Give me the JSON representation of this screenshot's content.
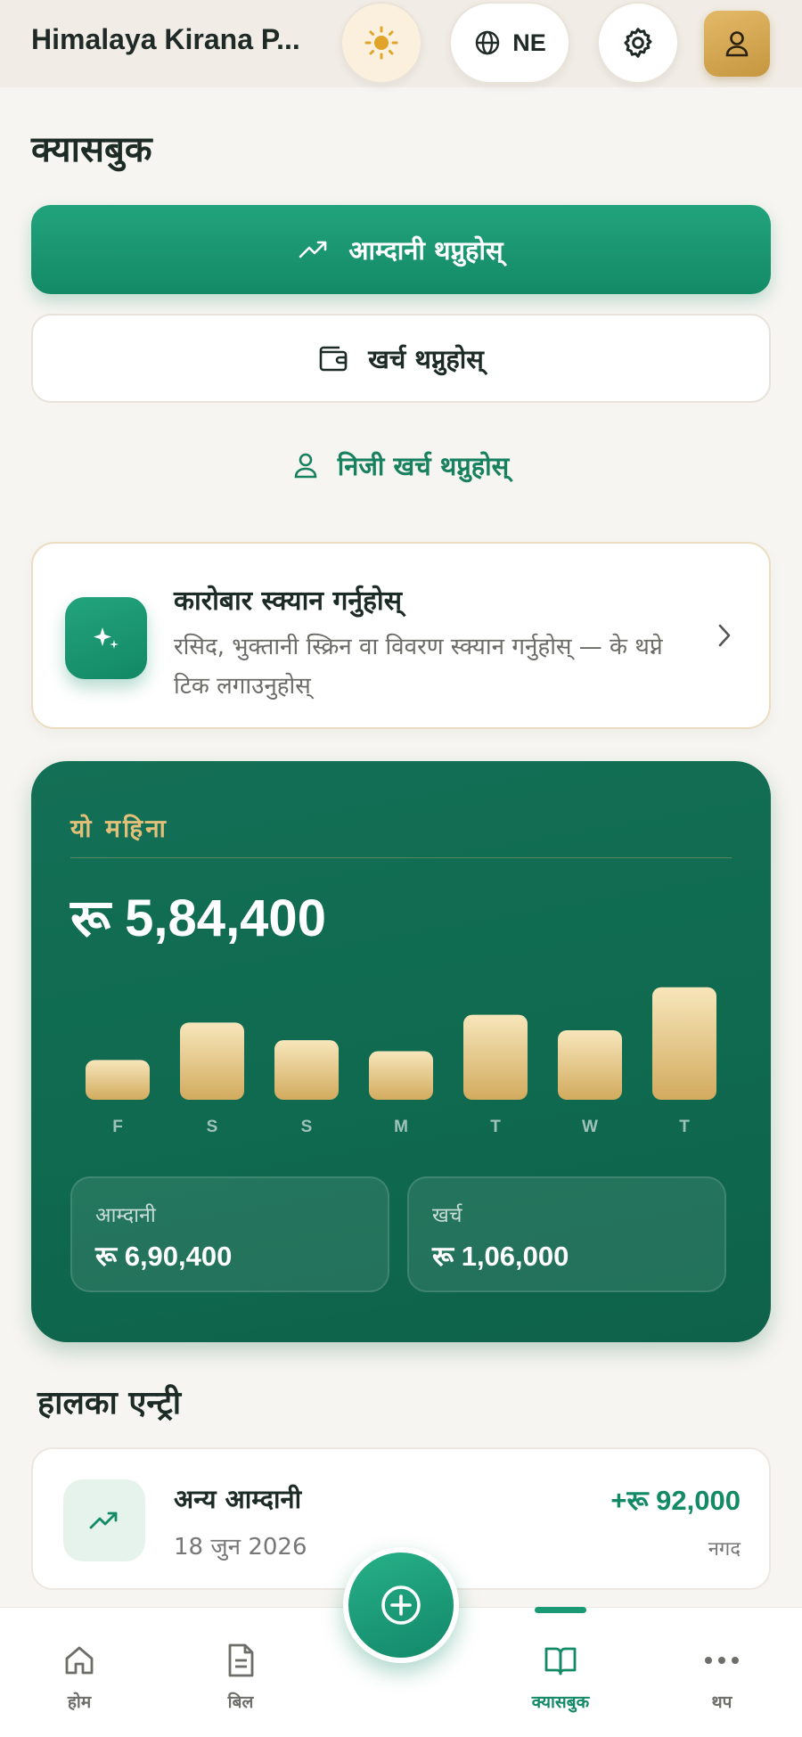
{
  "header": {
    "store_name": "Himalaya Kirana P...",
    "theme_icon": "sun-icon",
    "language": {
      "icon": "globe-icon",
      "label": "NE"
    },
    "settings_icon": "gear-icon",
    "profile_icon": "user-icon"
  },
  "page_title": "क्यासबुक",
  "actions": {
    "add_income": "आम्दानी थप्नुहोस्",
    "add_expense": "खर्च थप्नुहोस्",
    "add_personal_expense": "निजी खर्च थप्नुहोस्"
  },
  "scan_card": {
    "title": "कारोबार स्क्यान गर्नुहोस्",
    "description": "रसिद, भुक्तानी स्क्रिन वा विवरण स्क्यान गर्नुहोस् — के थप्ने टिक लगाउनुहोस्"
  },
  "summary": {
    "period": "यो महिना",
    "total": "रू 5,84,400",
    "income_label": "आम्दानी",
    "income_value": "रू 6,90,400",
    "expense_label": "खर्च",
    "expense_value": "रू 1,06,000"
  },
  "chart_data": {
    "type": "bar",
    "categories": [
      "F",
      "S",
      "S",
      "M",
      "T",
      "W",
      "T"
    ],
    "values": [
      36,
      70,
      54,
      44,
      77,
      63,
      102
    ],
    "ylim": [
      0,
      105
    ],
    "grid": false
  },
  "recent": {
    "title": "हालका एन्ट्री",
    "items": [
      {
        "name": "अन्य आम्दानी",
        "date": "18 जुन 2026",
        "amount": "+रू 92,000",
        "method": "नगद",
        "icon": "trending-up-icon"
      }
    ]
  },
  "nav": {
    "items": [
      {
        "label": "होम",
        "icon": "home-icon"
      },
      {
        "label": "बिल",
        "icon": "document-icon"
      },
      {
        "label": "क्यासबुक",
        "icon": "book-icon",
        "active": true
      },
      {
        "label": "थप",
        "icon": "more-icon"
      }
    ],
    "fab_icon": "plus-circle-icon"
  },
  "colors": {
    "primary": "#138a66",
    "gold": "#e2c07a",
    "card": "#0f6a4f",
    "background": "#f7f5f1"
  }
}
